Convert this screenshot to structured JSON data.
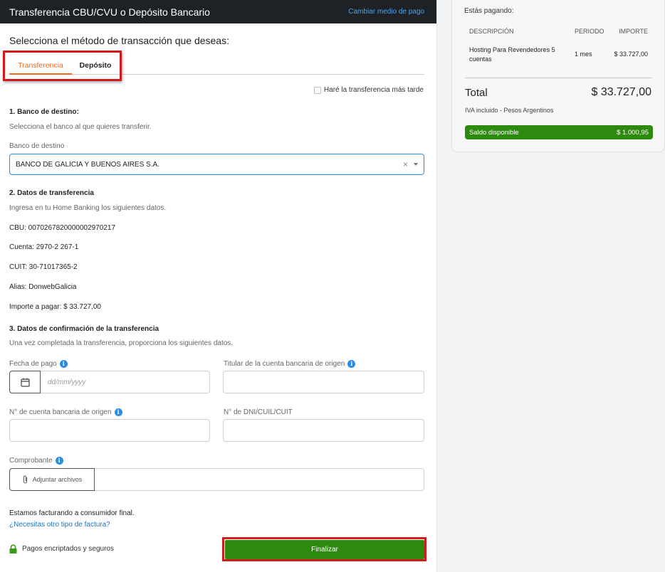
{
  "header": {
    "title": "Transferencia CBU/CVU o Depósito Bancario",
    "change_link": "Cambiar medio de pago"
  },
  "subtitle": "Selecciona el método de transacción que deseas:",
  "tabs": [
    {
      "label": "Transferencia",
      "active": true
    },
    {
      "label": "Depósito",
      "active": false
    }
  ],
  "later_checkbox": "Haré la transferencia más tarde",
  "section1": {
    "title": "1. Banco de destino:",
    "desc": "Selecciona el banco al que quieres transferir.",
    "field_label": "Banco de destino",
    "selected_bank": "BANCO DE GALICIA Y BUENOS AIRES S.A."
  },
  "section2": {
    "title": "2. Datos de transferencia",
    "desc": "Ingresa en tu Home Banking los siguientes datos.",
    "cbu": "CBU: 0070267820000002970217",
    "cuenta": "Cuenta: 2970-2 267-1",
    "cuit": "CUIT: 30-71017365-2",
    "alias": "Alias: DonwebGalicia",
    "importe": "Importe a pagar: $ 33.727,00"
  },
  "section3": {
    "title": "3. Datos de confirmación de la transferencia",
    "desc": "Una vez completada la transferencia, proporciona los siguientes datos.",
    "fecha_label": "Fecha de pago",
    "fecha_placeholder": "dd/mm/yyyy",
    "titular_label": "Titular de la cuenta bancaria de origen",
    "cuenta_label": "N° de cuenta bancaria de origen",
    "dni_label": "N° de DNI/CUIL/CUIT",
    "comprobante_label": "Comprobante",
    "adjuntar": "Adjuntar archivos"
  },
  "billing": {
    "text": "Estamos facturando a consumidor final.",
    "link": "¿Necesitas otro tipo de factura?"
  },
  "secure_text": "Pagos encriptados y seguros",
  "finalize_button": "Finalizar",
  "summary": {
    "paying": "Estás pagando:",
    "headers": {
      "desc": "DESCRIPCIÓN",
      "period": "PERIODO",
      "amount": "IMPORTE"
    },
    "item": {
      "desc_line1": "Hosting Para Revendedores 5",
      "desc_line2": "cuentas",
      "period": "1 mes",
      "amount": "$ 33.727,00"
    },
    "total_label": "Total",
    "total_value": "$ 33.727,00",
    "iva": "IVA incluido - Pesos Argentinos",
    "saldo_label": "Saldo disponible",
    "saldo_value": "$ 1.000,95"
  },
  "colors": {
    "accent": "#ef6a1f",
    "primary_green": "#2e8a0e",
    "link_blue": "#1a73c9",
    "highlight_red": "#d31a1a"
  }
}
